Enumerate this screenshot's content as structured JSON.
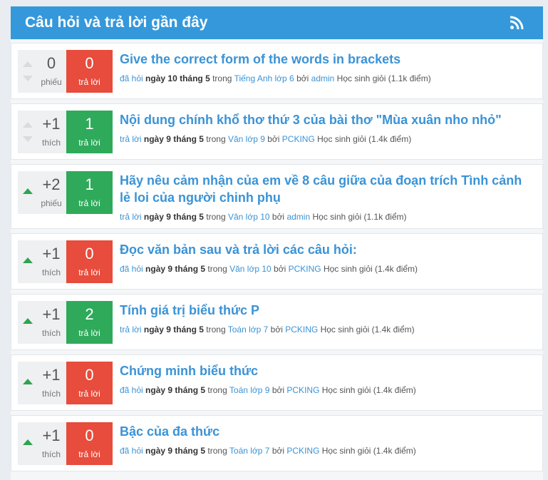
{
  "header": {
    "title": "Câu hỏi và trả lời gần đây",
    "rss_icon": "rss-icon"
  },
  "questions": [
    {
      "votes": "0",
      "vote_label": "phiếu",
      "upvoted": false,
      "answers": "0",
      "answer_label": "trả lời",
      "answered": false,
      "title": "Give the correct form of the words in brackets",
      "action": "đã hỏi",
      "when": "ngày 10 tháng 5",
      "in": "trong",
      "category": "Tiếng Anh lớp 6",
      "by": "bởi",
      "user": "admin",
      "rank": "Học sinh giỏi (1.1k điểm)"
    },
    {
      "votes": "+1",
      "vote_label": "thích",
      "upvoted": false,
      "answers": "1",
      "answer_label": "trả lời",
      "answered": true,
      "title": "Nội dung chính khổ thơ thứ 3 của bài thơ \"Mùa xuân nho nhỏ\"",
      "action": "trả lời",
      "when": "ngày 9 tháng 5",
      "in": "trong",
      "category": "Văn lớp 9",
      "by": "bởi",
      "user": "PCKING",
      "rank": "Học sinh giỏi (1.4k điểm)"
    },
    {
      "votes": "+2",
      "vote_label": "phiếu",
      "upvoted": true,
      "answers": "1",
      "answer_label": "trả lời",
      "answered": true,
      "title": "Hãy nêu cảm nhận của em về 8 câu giữa của đoạn trích Tình cảnh lẻ loi của người chinh phụ",
      "action": "trả lời",
      "when": "ngày 9 tháng 5",
      "in": "trong",
      "category": "Văn lớp 10",
      "by": "bởi",
      "user": "admin",
      "rank": "Học sinh giỏi (1.1k điểm)"
    },
    {
      "votes": "+1",
      "vote_label": "thích",
      "upvoted": true,
      "answers": "0",
      "answer_label": "trả lời",
      "answered": false,
      "title": "Đọc văn bản sau và trả lời các câu hỏi:",
      "action": "đã hỏi",
      "when": "ngày 9 tháng 5",
      "in": "trong",
      "category": "Văn lớp 10",
      "by": "bởi",
      "user": "PCKING",
      "rank": "Học sinh giỏi (1.4k điểm)"
    },
    {
      "votes": "+1",
      "vote_label": "thích",
      "upvoted": true,
      "answers": "2",
      "answer_label": "trả lời",
      "answered": true,
      "title": "Tính giá trị biểu thức P",
      "action": "trả lời",
      "when": "ngày 9 tháng 5",
      "in": "trong",
      "category": "Toán lớp 7",
      "by": "bởi",
      "user": "PCKING",
      "rank": "Học sinh giỏi (1.4k điểm)"
    },
    {
      "votes": "+1",
      "vote_label": "thích",
      "upvoted": true,
      "answers": "0",
      "answer_label": "trả lời",
      "answered": false,
      "title": "Chứng minh biểu thức",
      "action": "đã hỏi",
      "when": "ngày 9 tháng 5",
      "in": "trong",
      "category": "Toán lớp 9",
      "by": "bởi",
      "user": "PCKING",
      "rank": "Học sinh giỏi (1.4k điểm)"
    },
    {
      "votes": "+1",
      "vote_label": "thích",
      "upvoted": true,
      "answers": "0",
      "answer_label": "trả lời",
      "answered": false,
      "title": "Bậc của đa thức",
      "action": "đã hỏi",
      "when": "ngày 9 tháng 5",
      "in": "trong",
      "category": "Toán lớp 7",
      "by": "bởi",
      "user": "PCKING",
      "rank": "Học sinh giỏi (1.4k điểm)"
    }
  ]
}
